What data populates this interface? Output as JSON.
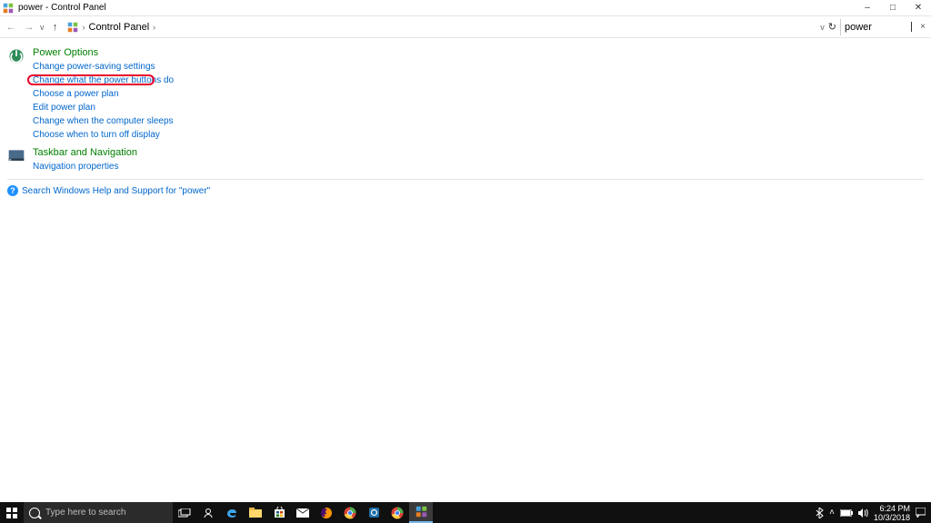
{
  "window": {
    "title": "power - Control Panel",
    "minimize": "–",
    "maximize": "□",
    "close": "✕"
  },
  "nav": {
    "back": "←",
    "forward": "→",
    "up": "↑",
    "breadcrumb_root": "Control Panel",
    "breadcrumb_sep1": "›",
    "breadcrumb_sep2": "›",
    "refresh": "↻",
    "search_value": "power",
    "clear": "×",
    "dropdown": "v"
  },
  "sections": {
    "power": {
      "title": "Power Options",
      "links": [
        "Change power-saving settings",
        "Change what the power buttons do",
        "Choose a power plan",
        "Edit power plan",
        "Change when the computer sleeps",
        "Choose when to turn off display"
      ]
    },
    "taskbar": {
      "title": "Taskbar and Navigation",
      "links": [
        "Navigation properties"
      ]
    }
  },
  "help": {
    "icon": "?",
    "text": "Search Windows Help and Support for \"power\""
  },
  "taskbar_os": {
    "search_placeholder": "Type here to search",
    "time": "6:24 PM",
    "date": "10/3/2018"
  }
}
